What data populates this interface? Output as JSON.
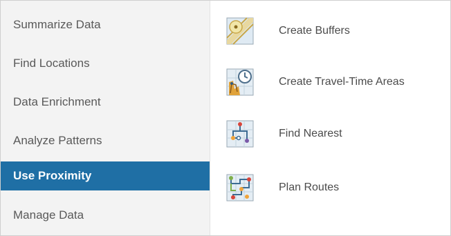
{
  "categories": [
    {
      "label": "Summarize Data"
    },
    {
      "label": "Find Locations"
    },
    {
      "label": "Data Enrichment"
    },
    {
      "label": "Analyze Patterns"
    },
    {
      "label": "Use Proximity",
      "selected": true
    },
    {
      "label": "Manage Data"
    }
  ],
  "tools": [
    {
      "label": "Create Buffers",
      "icon": "buffer-icon"
    },
    {
      "label": "Create Travel-Time Areas",
      "icon": "travel-time-icon"
    },
    {
      "label": "Find Nearest",
      "icon": "find-nearest-icon"
    },
    {
      "label": "Plan Routes",
      "icon": "plan-routes-icon"
    }
  ],
  "colors": {
    "selected_bg": "#1f6fa5",
    "sidebar_bg": "#f3f3f3",
    "text": "#595959"
  }
}
